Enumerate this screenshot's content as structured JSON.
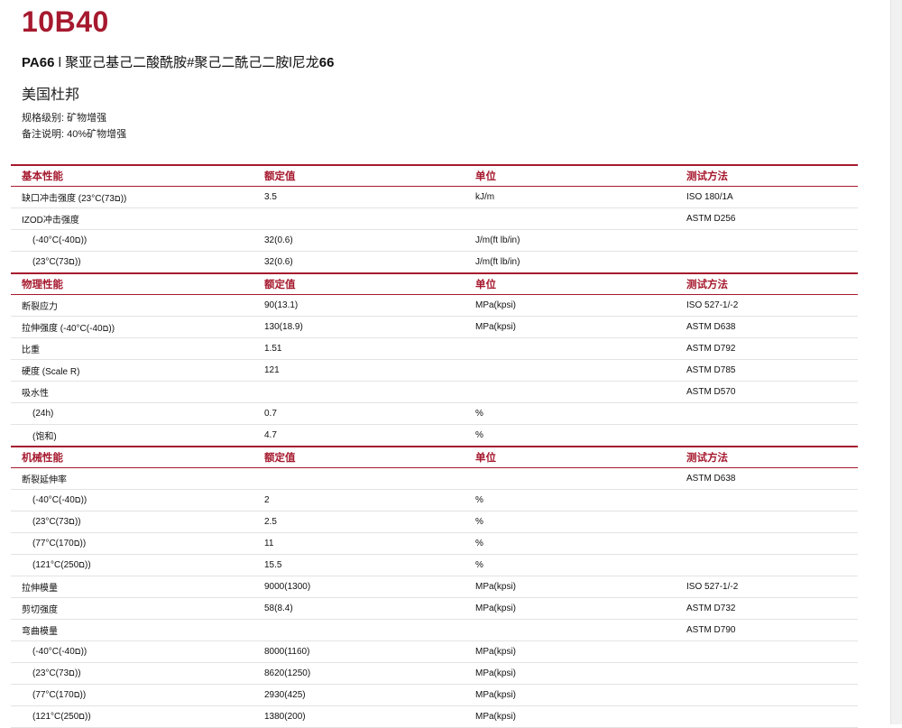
{
  "header": {
    "grade": "10B40",
    "subtitle_bold": "PA66",
    "subtitle_rest": " l 聚亚己基己二酸酰胺#聚己二酰己二胺l尼龙",
    "subtitle_tail": "66",
    "manufacturer": "美国杜邦",
    "spec_level": "规格级别: 矿物增强",
    "remark": "备注说明: 40%矿物增强"
  },
  "columns": {
    "value": "额定值",
    "unit": "单位",
    "method": "测试方法"
  },
  "sections": [
    {
      "name": "基本性能",
      "rows": [
        {
          "name": "缺口冲击强度 (23°C(73ם))",
          "value": "3.5",
          "unit": "kJ/m",
          "method": "ISO 180/1A",
          "sub": false
        },
        {
          "name": "IZOD冲击强度",
          "value": "",
          "unit": "",
          "method": "ASTM D256",
          "sub": false
        },
        {
          "name": "(-40°C(-40ם))",
          "value": "32(0.6)",
          "unit": "J/m(ft lb/in)",
          "method": "",
          "sub": true
        },
        {
          "name": "(23°C(73ם))",
          "value": "32(0.6)",
          "unit": "J/m(ft lb/in)",
          "method": "",
          "sub": true
        }
      ]
    },
    {
      "name": "物理性能",
      "rows": [
        {
          "name": "断裂应力",
          "value": "90(13.1)",
          "unit": "MPa(kpsi)",
          "method": "ISO 527-1/-2",
          "sub": false
        },
        {
          "name": "拉伸强度 (-40°C(-40ם))",
          "value": "130(18.9)",
          "unit": "MPa(kpsi)",
          "method": "ASTM D638",
          "sub": false
        },
        {
          "name": "比重",
          "value": "1.51",
          "unit": "",
          "method": "ASTM D792",
          "sub": false
        },
        {
          "name": "硬度 (Scale R)",
          "value": "121",
          "unit": "",
          "method": "ASTM D785",
          "sub": false
        },
        {
          "name": "吸水性",
          "value": "",
          "unit": "",
          "method": "ASTM D570",
          "sub": false
        },
        {
          "name": "(24h)",
          "value": "0.7",
          "unit": "%",
          "method": "",
          "sub": true
        },
        {
          "name": "(饱和)",
          "value": "4.7",
          "unit": "%",
          "method": "",
          "sub": true
        }
      ]
    },
    {
      "name": "机械性能",
      "rows": [
        {
          "name": "断裂延伸率",
          "value": "",
          "unit": "",
          "method": "ASTM D638",
          "sub": false
        },
        {
          "name": "(-40°C(-40ם))",
          "value": "2",
          "unit": "%",
          "method": "",
          "sub": true
        },
        {
          "name": "(23°C(73ם))",
          "value": "2.5",
          "unit": "%",
          "method": "",
          "sub": true
        },
        {
          "name": "(77°C(170ם))",
          "value": "11",
          "unit": "%",
          "method": "",
          "sub": true
        },
        {
          "name": "(121°C(250ם))",
          "value": "15.5",
          "unit": "%",
          "method": "",
          "sub": true
        },
        {
          "name": "拉伸模量",
          "value": "9000(1300)",
          "unit": "MPa(kpsi)",
          "method": "ISO 527-1/-2",
          "sub": false
        },
        {
          "name": "剪切强度",
          "value": "58(8.4)",
          "unit": "MPa(kpsi)",
          "method": "ASTM D732",
          "sub": false
        },
        {
          "name": "弯曲模量",
          "value": "",
          "unit": "",
          "method": "ASTM D790",
          "sub": false
        },
        {
          "name": "(-40°C(-40ם))",
          "value": "8000(1160)",
          "unit": "MPa(kpsi)",
          "method": "",
          "sub": true
        },
        {
          "name": "(23°C(73ם))",
          "value": "8620(1250)",
          "unit": "MPa(kpsi)",
          "method": "",
          "sub": true
        },
        {
          "name": "(77°C(170ם))",
          "value": "2930(425)",
          "unit": "MPa(kpsi)",
          "method": "",
          "sub": true
        },
        {
          "name": "(121°C(250ם))",
          "value": "1380(200)",
          "unit": "MPa(kpsi)",
          "method": "",
          "sub": true
        }
      ]
    }
  ],
  "colors": {
    "accent": "#a6192e",
    "text": "#111111",
    "row_rule": "#e3e3e3"
  }
}
